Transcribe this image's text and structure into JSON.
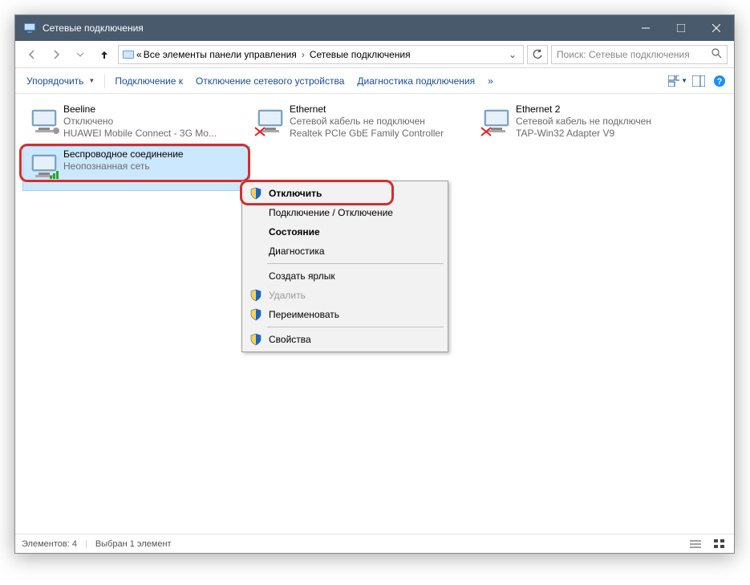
{
  "window": {
    "title": "Сетевые подключения"
  },
  "breadcrumb": {
    "prefix": "«",
    "part1": "Все элементы панели управления",
    "part2": "Сетевые подключения"
  },
  "search": {
    "placeholder": "Поиск: Сетевые подключения"
  },
  "toolbar": {
    "organize": "Упорядочить",
    "connect": "Подключение к",
    "disable": "Отключение сетевого устройства",
    "diagnose": "Диагностика подключения",
    "more": "»"
  },
  "items": [
    {
      "name": "Beeline",
      "status": "Отключено",
      "device": "HUAWEI Mobile Connect - 3G Mo...",
      "crossed": false
    },
    {
      "name": "Ethernet",
      "status": "Сетевой кабель не подключен",
      "device": "Realtek PCIe GbE Family Controller",
      "crossed": true
    },
    {
      "name": "Ethernet 2",
      "status": "Сетевой кабель не подключен",
      "device": "TAP-Win32 Adapter V9",
      "crossed": true
    },
    {
      "name": "Беспроводное соединение",
      "status": "Неопознанная сеть",
      "device": "",
      "crossed": false
    }
  ],
  "context_menu": {
    "disconnect": "Отключить",
    "toggle": "Подключение / Отключение",
    "state": "Состояние",
    "diag": "Диагностика",
    "shortcut": "Создать ярлык",
    "delete": "Удалить",
    "rename": "Переименовать",
    "properties": "Свойства"
  },
  "statusbar": {
    "count": "Элементов: 4",
    "selection": "Выбран 1 элемент"
  }
}
